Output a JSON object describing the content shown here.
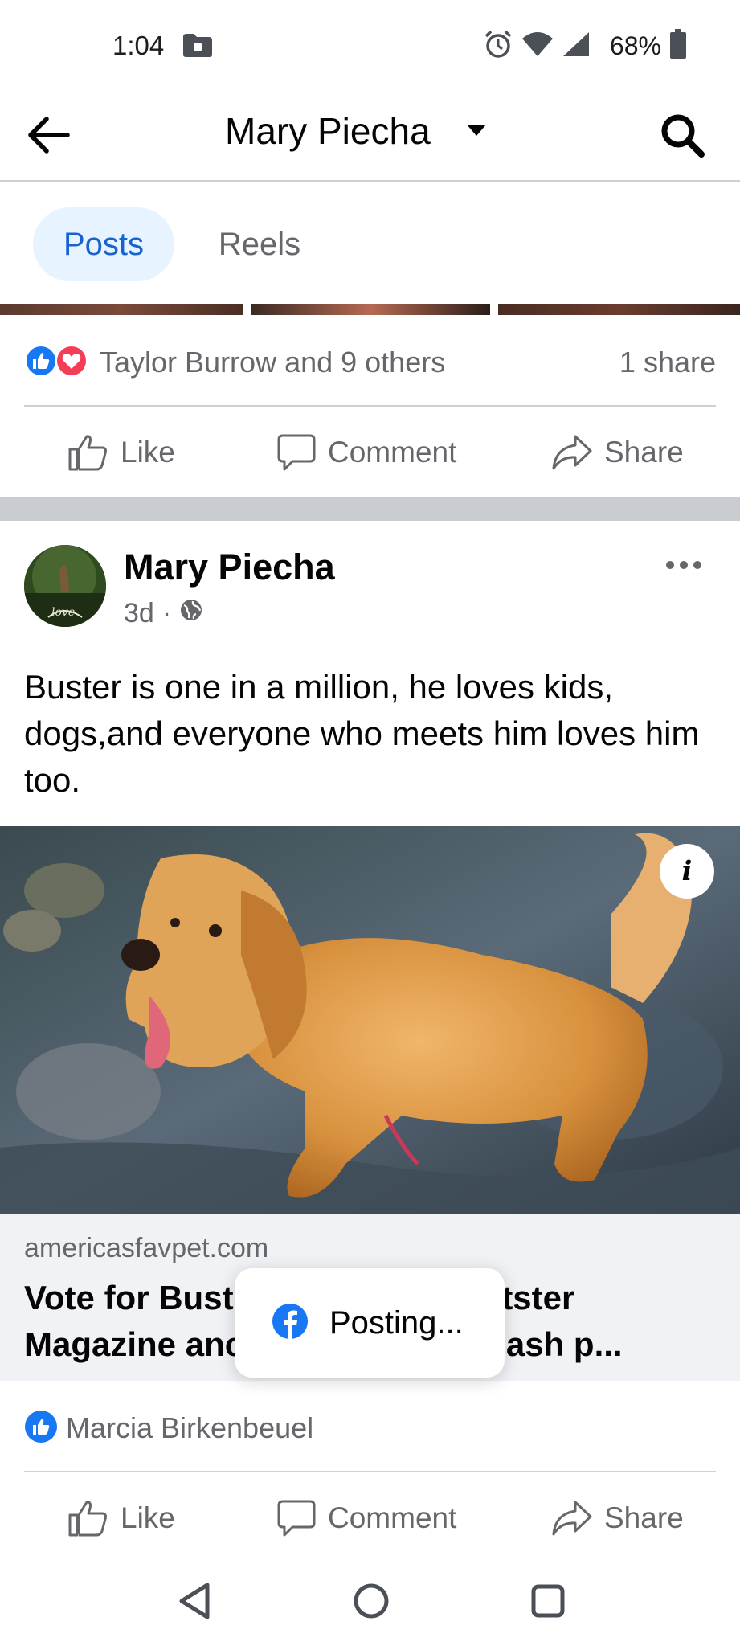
{
  "status_bar": {
    "time": "1:04",
    "battery": "68%",
    "icons": [
      "folder-icon",
      "alarm-icon",
      "wifi-icon",
      "signal-icon",
      "battery-icon"
    ]
  },
  "header": {
    "title": "Mary Piecha"
  },
  "tabs": [
    {
      "label": "Posts",
      "selected": true
    },
    {
      "label": "Reels",
      "selected": false
    }
  ],
  "prev_post": {
    "reactions_text": "Taylor Burrow and 9 others",
    "shares_text": "1 share"
  },
  "actions": {
    "like": "Like",
    "comment": "Comment",
    "share": "Share"
  },
  "post": {
    "author": "Mary Piecha",
    "time": "3d",
    "separator": "·",
    "avatar_text": "love",
    "text": "Buster is one in a million, he loves kids, dogs,and everyone who meets him loves him too.",
    "link": {
      "domain": "americasfavpet.com",
      "title": "Vote for Bust               er or Catster\nMagazine anc                  ,000 cash p..."
    },
    "likes_text": "Marcia Birkenbeuel"
  },
  "toast": {
    "text": "Posting..."
  },
  "colors": {
    "accent_blue": "#1877f2",
    "tab_selected_bg": "#e7f3ff",
    "tab_selected_text": "#1763cf",
    "secondary_text": "#65676b",
    "love_red": "#f33e58"
  }
}
